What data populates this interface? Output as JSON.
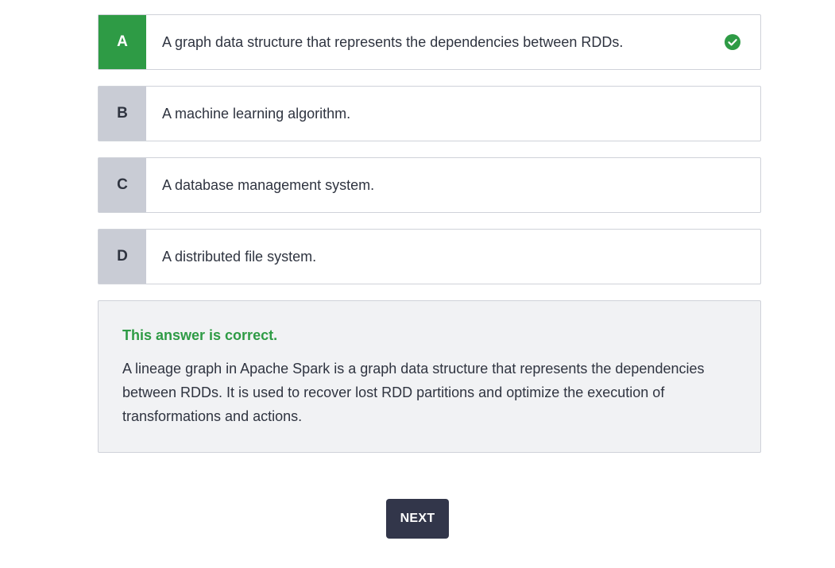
{
  "options": [
    {
      "letter": "A",
      "text": "A graph data structure that represents the dependencies between RDDs.",
      "correct": true
    },
    {
      "letter": "B",
      "text": "A machine learning algorithm.",
      "correct": false
    },
    {
      "letter": "C",
      "text": "A database management system.",
      "correct": false
    },
    {
      "letter": "D",
      "text": "A distributed file system.",
      "correct": false
    }
  ],
  "feedback": {
    "verdict": "This answer is correct.",
    "explanation": "A lineage graph in Apache Spark is a graph data structure that represents the dependencies between RDDs. It is used to recover lost RDD partitions and optimize the execution of transformations and actions."
  },
  "next_button": {
    "label": "NEXT"
  },
  "colors": {
    "correct": "#2e9b45",
    "letter_bg": "#c9ccd5",
    "button_bg": "#32364a",
    "feedback_bg": "#f1f2f4"
  },
  "icons": {
    "correct_indicator": "check-circle-icon"
  }
}
